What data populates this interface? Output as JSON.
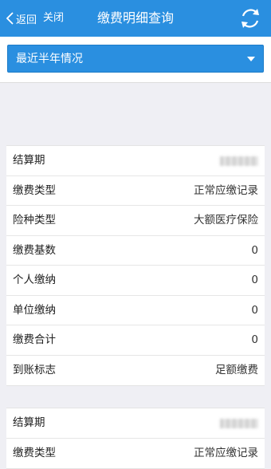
{
  "header": {
    "back_label": "返回",
    "close_label": "关闭",
    "title": "缴费明细查询",
    "refresh_icon": "refresh-icon"
  },
  "filter": {
    "selected": "最近半年情况"
  },
  "records": [
    {
      "rows": [
        {
          "label": "结算期",
          "value": ""
        },
        {
          "label": "缴费类型",
          "value": "正常应缴记录"
        },
        {
          "label": "险种类型",
          "value": "大额医疗保险"
        },
        {
          "label": "缴费基数",
          "value": "0"
        },
        {
          "label": "个人缴纳",
          "value": "0"
        },
        {
          "label": "单位缴纳",
          "value": "0"
        },
        {
          "label": "缴费合计",
          "value": "0"
        },
        {
          "label": "到账标志",
          "value": "足额缴费"
        }
      ]
    },
    {
      "rows": [
        {
          "label": "结算期",
          "value": ""
        },
        {
          "label": "缴费类型",
          "value": "正常应缴记录"
        }
      ]
    }
  ],
  "colors": {
    "accent": "#2a8fe0",
    "background": "#efeff4"
  }
}
